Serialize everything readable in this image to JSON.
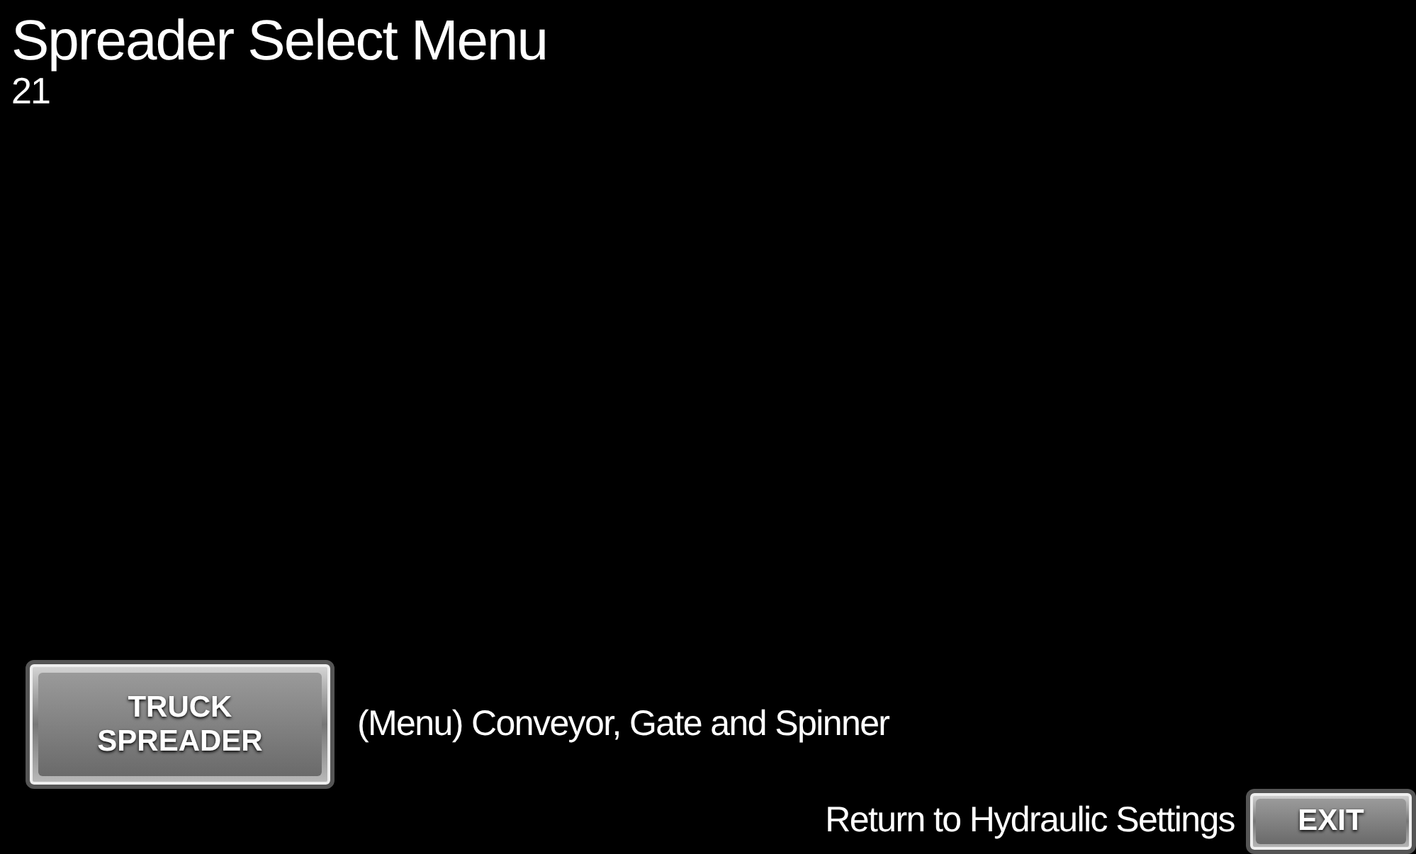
{
  "title": "Spreader Select Menu",
  "screen_number": "21",
  "menu_items": [
    {
      "button": "TRUCK\nSPREADER",
      "description": "(Menu) Conveyor, Gate and Spinner"
    }
  ],
  "exit": {
    "description": "Return to Hydraulic Settings",
    "button": "EXIT"
  }
}
